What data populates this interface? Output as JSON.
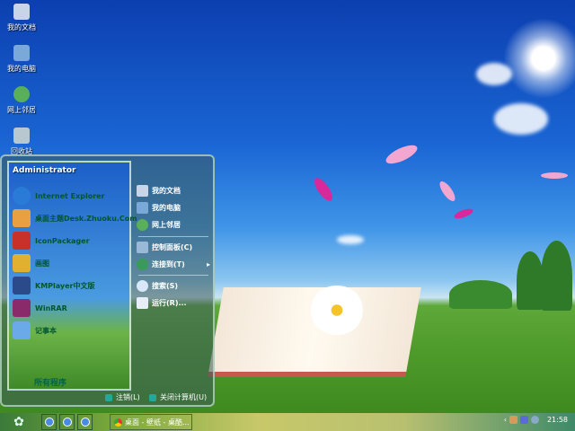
{
  "desktop_icons": [
    {
      "label": "我的文档",
      "icon": "my-documents-icon"
    },
    {
      "label": "我的电脑",
      "icon": "my-computer-icon"
    },
    {
      "label": "网上邻居",
      "icon": "network-places-icon"
    },
    {
      "label": "回收站",
      "icon": "recycle-bin-icon"
    }
  ],
  "start_menu": {
    "user": "Administrator",
    "programs": [
      {
        "label": "Internet Explorer",
        "color": "#2a7ad8"
      },
      {
        "label": "桌面主题Desk.Zhuoku.Com",
        "color": "#e8a040"
      },
      {
        "label": "IconPackager",
        "color": "#c8302a"
      },
      {
        "label": "画图",
        "color": "#e0b030"
      },
      {
        "label": "KMPlayer中文版",
        "color": "#2a4a8a"
      },
      {
        "label": "WinRAR",
        "color": "#8a2a6a"
      },
      {
        "label": "记事本",
        "color": "#6aaae8"
      }
    ],
    "all_programs": "所有程序",
    "places": [
      {
        "label": "我的文档"
      },
      {
        "label": "我的电脑"
      },
      {
        "label": "网上邻居"
      }
    ],
    "system": [
      {
        "label": "控制面板(C)"
      },
      {
        "label": "连接到(T)",
        "arrow": "▸"
      }
    ],
    "tools": [
      {
        "label": "搜索(S)"
      },
      {
        "label": "运行(R)..."
      }
    ],
    "logoff": "注销(L)",
    "shutdown": "关闭计算机(U)"
  },
  "taskbar": {
    "start_glyph": "✿",
    "task": "桌面 - 壁纸 - 桌酷...",
    "clock": "21:58",
    "tray_arrow": "‹"
  }
}
